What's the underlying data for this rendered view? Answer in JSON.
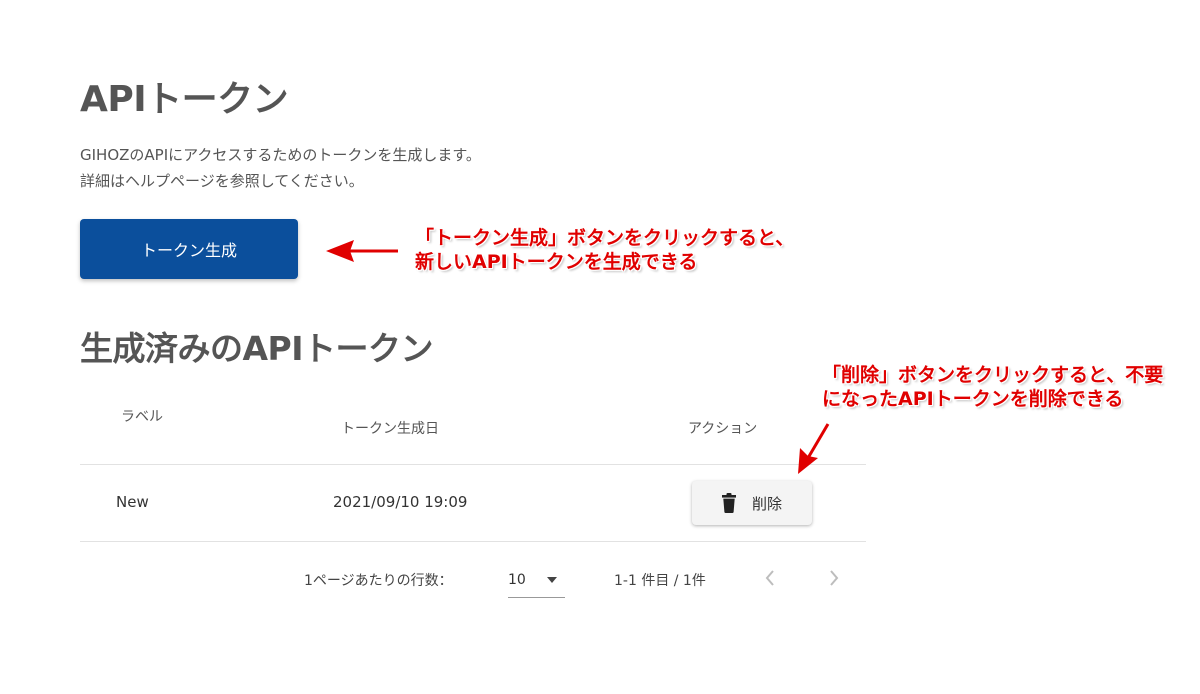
{
  "page": {
    "title": "APIトークン",
    "description_line1": "GIHOZのAPIにアクセスするためのトークンを生成します。",
    "description_line2": "詳細はヘルプページを参照してください。",
    "generate_button_label": "トークン生成",
    "section_title": "生成済みのAPIトークン"
  },
  "table": {
    "columns": [
      "ラベル",
      "トークン生成日",
      "アクション"
    ],
    "rows": [
      {
        "label": "New",
        "created_at": "2021/09/10 19:09",
        "action_label": "削除"
      }
    ]
  },
  "pagination": {
    "rows_per_page_label": "1ページあたりの行数：",
    "rows_per_page_value": "10",
    "range_text": "1-1 件目 / 1件"
  },
  "annotations": {
    "generate_line1": "「トークン生成」ボタンをクリックすると、",
    "generate_line2": "新しいAPIトークンを生成できる",
    "delete_line1": "「削除」ボタンをクリックすると、不要",
    "delete_line2": "になったAPIトークンを削除できる"
  },
  "colors": {
    "primary": "#0b4f9c",
    "annotation": "#e00000"
  },
  "icons": {
    "delete": "trash-icon",
    "rows_dropdown": "caret-down-icon",
    "prev": "chevron-left-icon",
    "next": "chevron-right-icon"
  }
}
